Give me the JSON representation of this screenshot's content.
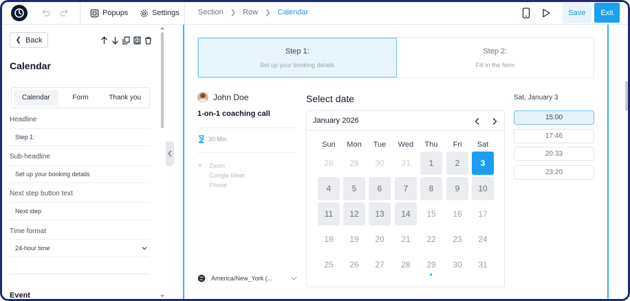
{
  "toolbar": {
    "popups_label": "Popups",
    "settings_label": "Settings",
    "save_label": "Save",
    "exit_label": "Exit",
    "breadcrumbs": [
      "Section",
      "Row",
      "Calendar"
    ]
  },
  "sidebar": {
    "back_label": "Back",
    "title": "Calendar",
    "tabs": [
      "Calendar",
      "Form",
      "Thank you"
    ],
    "fields": [
      {
        "label": "Headline",
        "value": "Step 1:"
      },
      {
        "label": "Sub-headline",
        "value": "Set up your booking details"
      },
      {
        "label": "Next step button text",
        "value": "Next step"
      },
      {
        "label": "Time format",
        "value": "24-hour time"
      }
    ],
    "section_heading": "Event"
  },
  "steps": [
    {
      "title": "Step 1:",
      "subtitle": "Set up your booking details"
    },
    {
      "title": "Step 2:",
      "subtitle": "Fill in the form"
    }
  ],
  "event": {
    "host_name": "John Doe",
    "name": "1-on-1 coaching call",
    "duration": "30 Min",
    "locations": [
      "Zoom",
      "Google Meet",
      "Phone"
    ],
    "timezone": "America/New_York (..."
  },
  "calendar": {
    "heading": "Select date",
    "month": "January",
    "year": "2026",
    "weekdays": [
      "Sun",
      "Mon",
      "Tue",
      "Wed",
      "Thu",
      "Fri",
      "Sat"
    ],
    "days": [
      [
        "28",
        "29",
        "30",
        "31",
        "1",
        "2",
        "3"
      ],
      [
        "4",
        "5",
        "6",
        "7",
        "8",
        "9",
        "10"
      ],
      [
        "11",
        "12",
        "13",
        "14",
        "15",
        "16",
        "17"
      ],
      [
        "18",
        "19",
        "20",
        "21",
        "22",
        "23",
        "24"
      ],
      [
        "25",
        "26",
        "27",
        "28",
        "29",
        "30",
        "31"
      ]
    ]
  },
  "times": {
    "date_label": "Sat, January 3",
    "slots": [
      "15:00",
      "17:46",
      "20:33",
      "23:20"
    ]
  },
  "colors": {
    "accent": "#1a9ff0",
    "frame": "#1e2a78",
    "canvas_edge": "#39b2ee"
  }
}
